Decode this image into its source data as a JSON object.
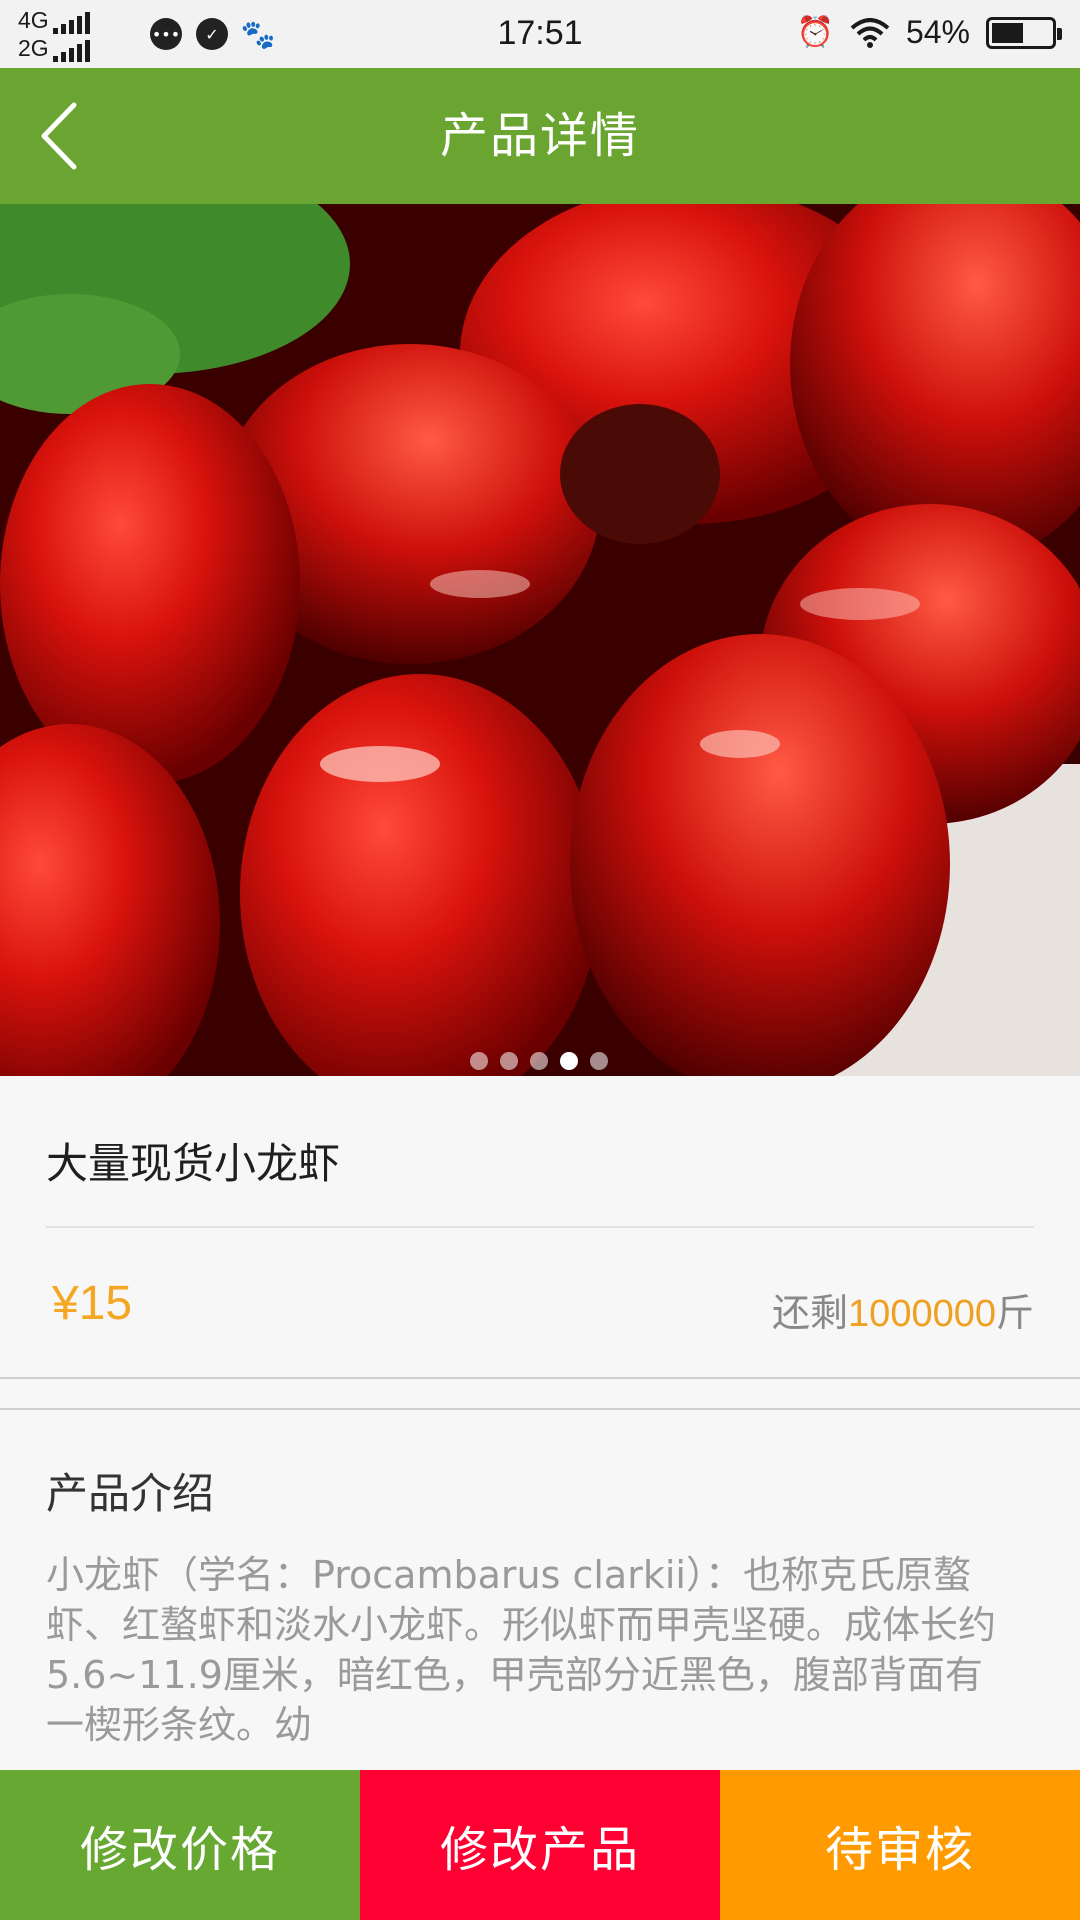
{
  "status_bar": {
    "network_top": "4G",
    "network_bottom": "2G",
    "time": "17:51",
    "battery": "54%",
    "battery_level": 0.54,
    "icons": [
      "chat-icon",
      "check-icon",
      "baidu-icon",
      "alarm-icon",
      "wifi-icon"
    ]
  },
  "header": {
    "title": "产品详情",
    "back_icon": "chevron-left-icon"
  },
  "carousel": {
    "slide_count": 5,
    "active_index": 3
  },
  "product": {
    "name": "大量现货小龙虾",
    "price": "¥15",
    "stock_prefix": "还剩",
    "stock_amount": "1000000",
    "stock_unit": "斤"
  },
  "intro": {
    "heading": "产品介绍",
    "text": "小龙虾（学名：Procambarus clarkii）：也称克氏原螯虾、红螯虾和淡水小龙虾。形似虾而甲壳坚硬。成体长约5.6~11.9厘米，暗红色，甲壳部分近黑色，腹部背面有一楔形条纹。幼"
  },
  "actions": {
    "modify_price": "修改价格",
    "modify_product": "修改产品",
    "pending_review": "待审核"
  },
  "colors": {
    "header_green": "#6aa532",
    "price_orange": "#f5a623",
    "button_green": "#66a832",
    "button_red": "#ff0033",
    "button_orange": "#ff9a00"
  }
}
